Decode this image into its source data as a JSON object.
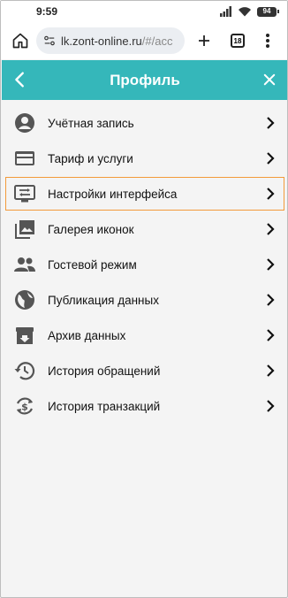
{
  "status_bar": {
    "time": "9:59",
    "battery": "94"
  },
  "browser": {
    "url_host": "lk.zont-online.ru",
    "url_path": "/#/acc",
    "tabs_count": "18"
  },
  "header": {
    "title": "Профиль"
  },
  "menu": {
    "items": [
      {
        "label": "Учётная запись",
        "icon": "account-icon"
      },
      {
        "label": "Тариф и услуги",
        "icon": "credit-card-icon"
      },
      {
        "label": "Настройки интерфейса",
        "icon": "interface-settings-icon",
        "highlighted": true
      },
      {
        "label": "Галерея иконок",
        "icon": "image-gallery-icon"
      },
      {
        "label": "Гостевой режим",
        "icon": "guests-icon"
      },
      {
        "label": "Публикация данных",
        "icon": "globe-icon"
      },
      {
        "label": "Архив данных",
        "icon": "archive-icon"
      },
      {
        "label": "История обращений",
        "icon": "history-icon"
      },
      {
        "label": "История транзакций",
        "icon": "transaction-history-icon"
      }
    ]
  },
  "colors": {
    "accent": "#35b7ba",
    "highlight_border": "#f39a3a",
    "icon": "#424242"
  }
}
